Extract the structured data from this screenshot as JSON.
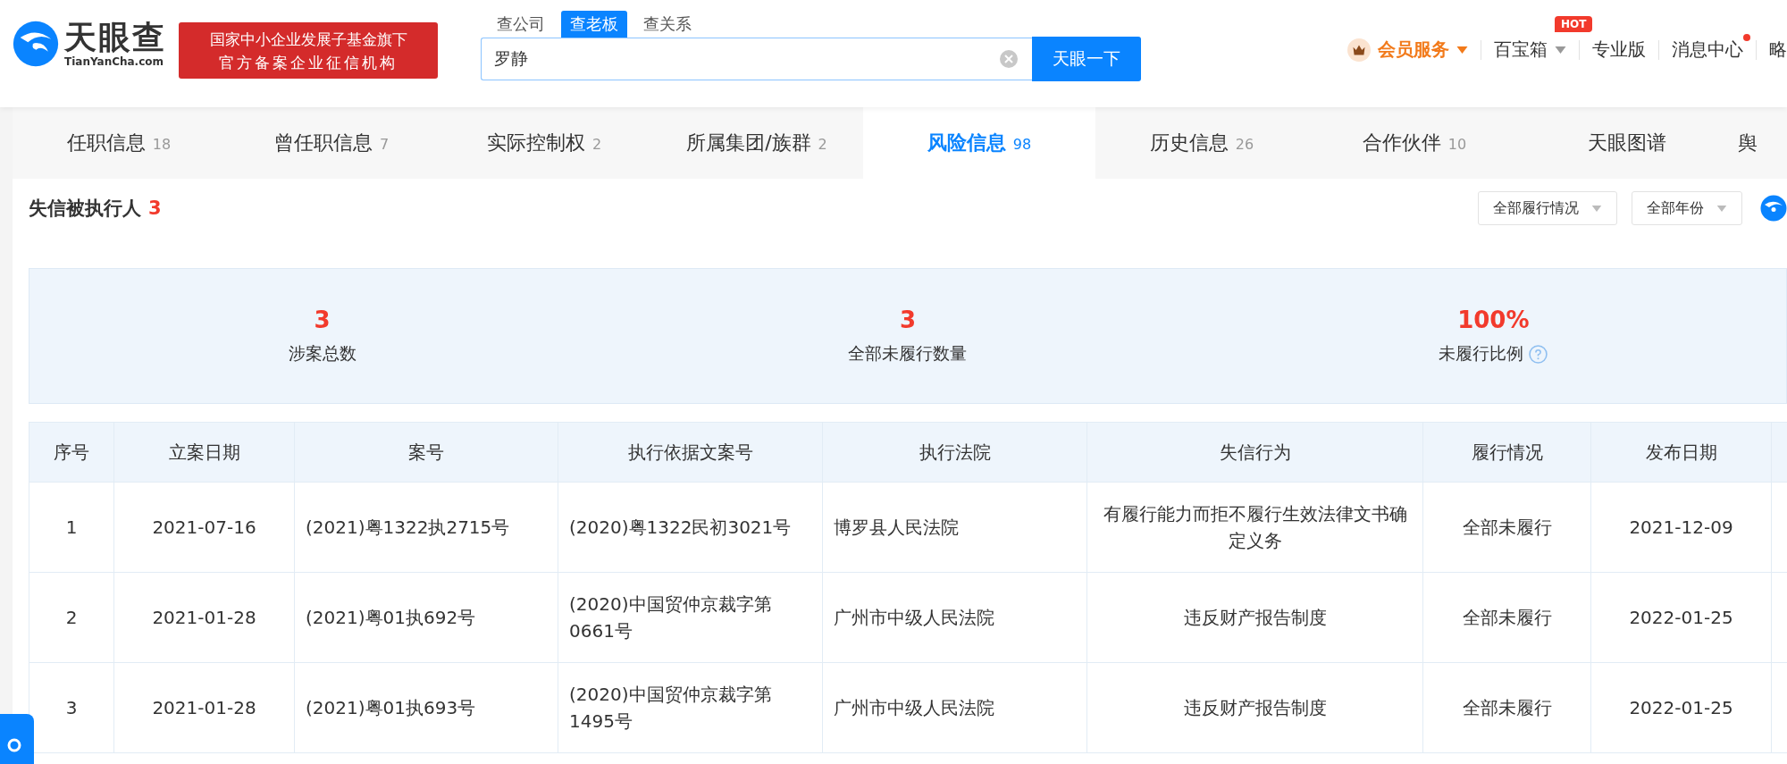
{
  "logo": {
    "name": "天眼查",
    "domain": "TianYanCha.com"
  },
  "badge": [
    "国家中小企业发展子基金旗下",
    "官方备案企业征信机构"
  ],
  "search": {
    "tabs": [
      {
        "label": "查公司",
        "selected": false
      },
      {
        "label": "查老板",
        "selected": true
      },
      {
        "label": "查关系",
        "selected": false
      }
    ],
    "value": "罗静",
    "button": "天眼一下"
  },
  "nav": [
    {
      "kind": "member",
      "label": "会员服务"
    },
    {
      "kind": "dropdown",
      "label": "百宝箱",
      "badge": "HOT"
    },
    {
      "kind": "link",
      "label": "专业版"
    },
    {
      "kind": "notify",
      "label": "消息中心",
      "unread": true
    },
    {
      "kind": "link",
      "label": "略"
    }
  ],
  "tabs": [
    {
      "label": "任职信息",
      "count": "18",
      "selected": false
    },
    {
      "label": "曾任职信息",
      "count": "7",
      "selected": false
    },
    {
      "label": "实际控制权",
      "count": "2",
      "selected": false
    },
    {
      "label": "所属集团/族群",
      "count": "2",
      "selected": false
    },
    {
      "label": "风险信息",
      "count": "98",
      "selected": true
    },
    {
      "label": "历史信息",
      "count": "26",
      "selected": false
    },
    {
      "label": "合作伙伴",
      "count": "10",
      "selected": false
    },
    {
      "label": "天眼图谱",
      "selected": false
    },
    {
      "label": "舆",
      "selected": false
    }
  ],
  "section": {
    "title": "失信被执行人",
    "count": "3",
    "filters": [
      "全部履行情况",
      "全部年份"
    ]
  },
  "stats": [
    {
      "value": "3",
      "label": "涉案总数",
      "help": false
    },
    {
      "value": "3",
      "label": "全部未履行数量",
      "help": false
    },
    {
      "value": "100%",
      "label": "未履行比例",
      "help": true
    }
  ],
  "table": {
    "columns": [
      "序号",
      "立案日期",
      "案号",
      "执行依据文案号",
      "执行法院",
      "失信行为",
      "履行情况",
      "发布日期"
    ],
    "rows": [
      [
        "1",
        "2021-07-16",
        "(2021)粤1322执2715号",
        "(2020)粤1322民初3021号",
        "博罗县人民法院",
        "有履行能力而拒不履行生效法律文书确定义务",
        "全部未履行",
        "2021-12-09"
      ],
      [
        "2",
        "2021-01-28",
        "(2021)粤01执692号",
        "(2020)中国贸仲京裁字第0661号",
        "广州市中级人民法院",
        "违反财产报告制度",
        "全部未履行",
        "2022-01-25"
      ],
      [
        "3",
        "2021-01-28",
        "(2021)粤01执693号",
        "(2020)中国贸仲京裁字第1495号",
        "广州市中级人民法院",
        "违反财产报告制度",
        "全部未履行",
        "2022-01-25"
      ]
    ]
  }
}
